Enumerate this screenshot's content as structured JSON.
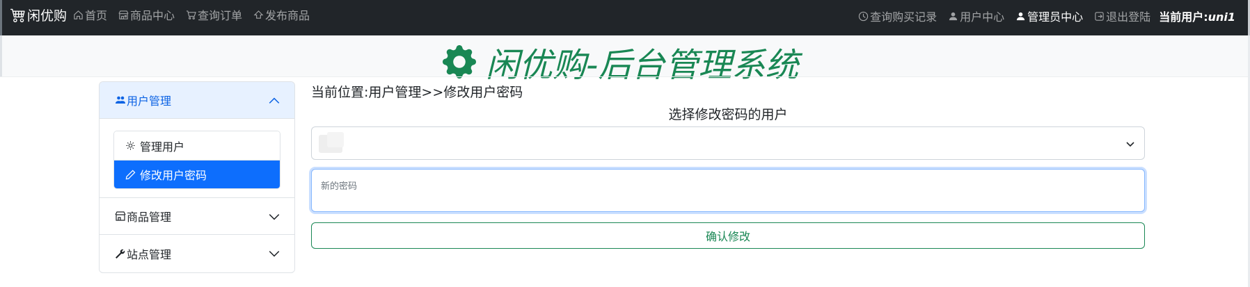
{
  "navbar": {
    "brand": "闲优购",
    "left_items": [
      {
        "label": "首页",
        "icon": "house-icon"
      },
      {
        "label": "商品中心",
        "icon": "shop-icon"
      },
      {
        "label": "查询订单",
        "icon": "cart-icon"
      },
      {
        "label": "发布商品",
        "icon": "upload-icon"
      }
    ],
    "right_items": [
      {
        "label": "查询购买记录",
        "icon": "clock-icon"
      },
      {
        "label": "用户中心",
        "icon": "person-icon"
      },
      {
        "label": "管理员中心",
        "icon": "person-icon"
      },
      {
        "label": "退出登陆",
        "icon": "logout-icon"
      }
    ],
    "current_user_prefix": "当前用户:",
    "current_user_name": "uni1"
  },
  "header": {
    "title": "闲优购-后台管理系统",
    "accent_color": "#198754"
  },
  "sidebar": {
    "sections": [
      {
        "label": "用户管理",
        "icon": "people-icon",
        "open": true
      },
      {
        "label": "商品管理",
        "icon": "shop-icon",
        "open": false
      },
      {
        "label": "站点管理",
        "icon": "wrench-icon",
        "open": false
      }
    ],
    "user_items": [
      {
        "label": "管理用户",
        "icon": "gear-icon",
        "active": false
      },
      {
        "label": "修改用户密码",
        "icon": "pencil-icon",
        "active": true
      }
    ]
  },
  "main": {
    "breadcrumb": "当前位置:用户管理>>修改用户密码",
    "select_label": "选择修改密码的用户",
    "password_placeholder": "新的密码",
    "confirm_label": "确认修改"
  },
  "colors": {
    "navbar_bg": "#212529",
    "primary": "#0d6efd",
    "success": "#198754"
  }
}
